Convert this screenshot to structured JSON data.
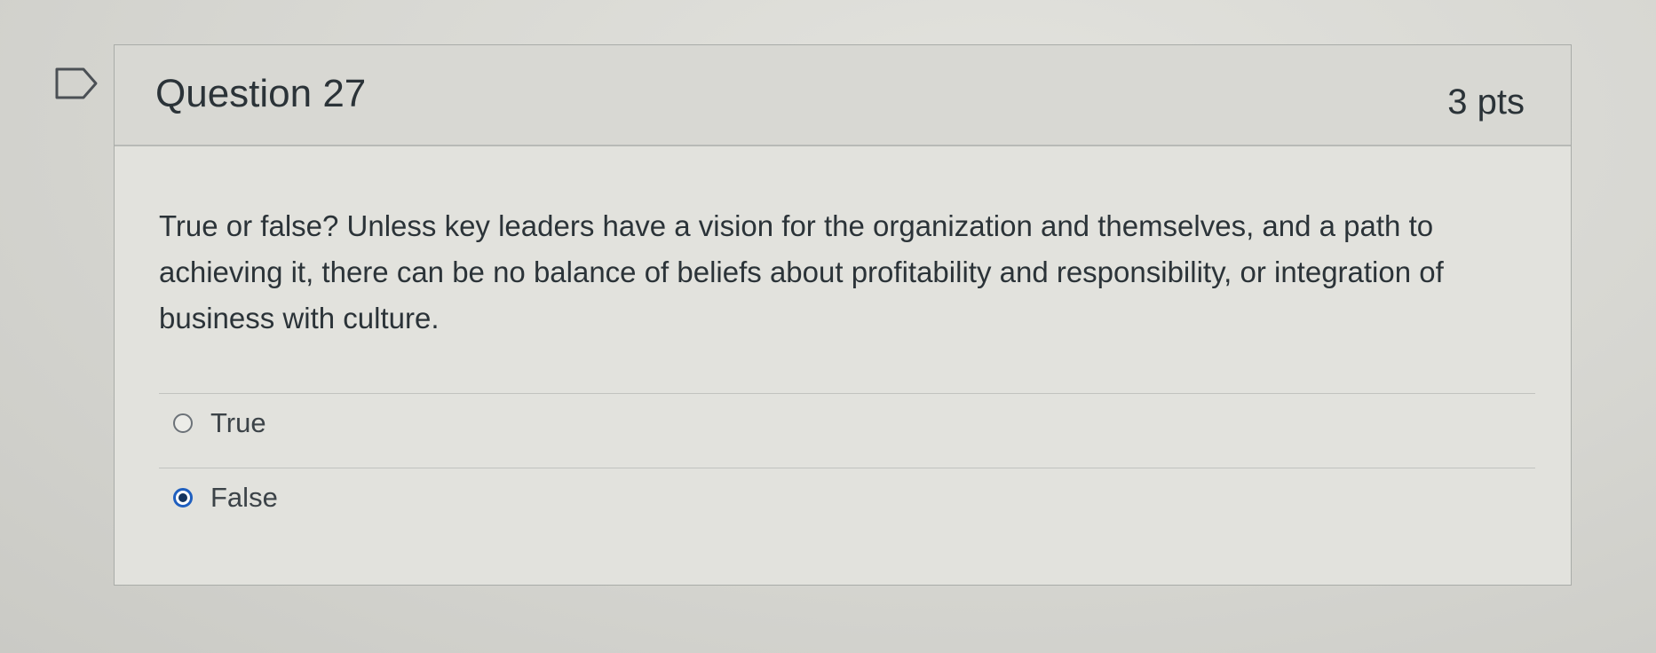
{
  "question": {
    "title": "Question 27",
    "points": "3 pts",
    "text": "True or false? Unless key leaders have a vision for the organization and themselves, and a path to achieving it, there can be no balance of beliefs about profitability and responsibility, or integration of business with culture.",
    "flag_icon": "flag-question-icon",
    "answers": [
      {
        "label": "True",
        "selected": false
      },
      {
        "label": "False",
        "selected": true
      }
    ]
  },
  "colors": {
    "selected_radio": "#1f5fbf",
    "text": "#2b3338"
  }
}
